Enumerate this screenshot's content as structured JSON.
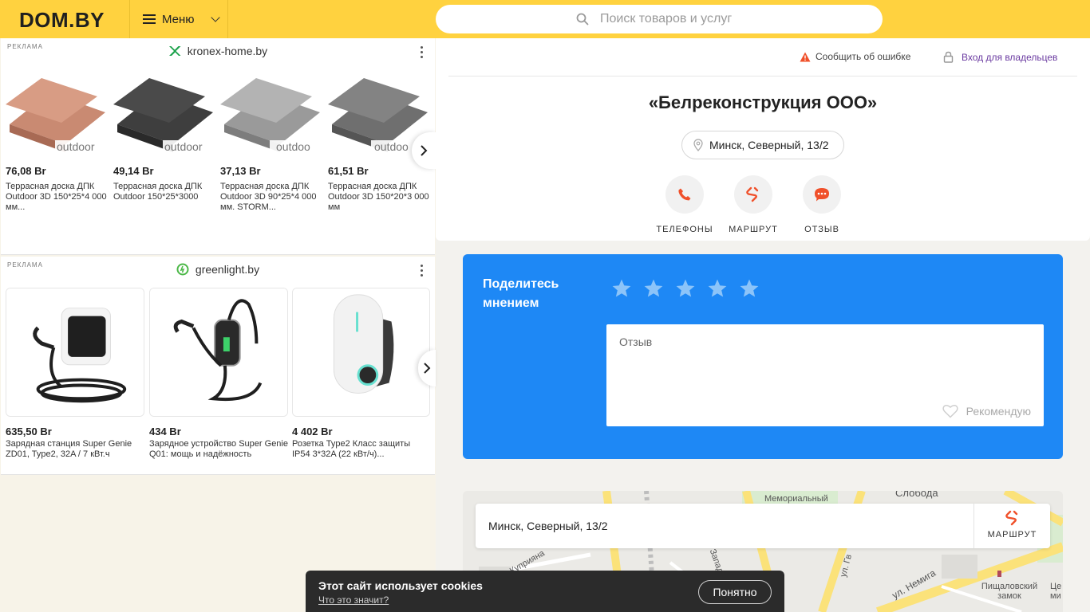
{
  "header": {
    "logo": "DOM.BY",
    "menu_label": "Меню",
    "search_placeholder": "Поиск товаров и услуг"
  },
  "ads": {
    "ad1": {
      "tag": "РЕКЛАМА",
      "source": "kronex-home.by",
      "products": [
        {
          "price": "76,08 Br",
          "name": "Террасная доска ДПК Outdoor 3D 150*25*4 000 мм...",
          "brand": "outdoor",
          "color": "#c98a72"
        },
        {
          "price": "49,14 Br",
          "name": "Террасная доска ДПК Outdoor 150*25*3000",
          "brand": "outdoor",
          "color": "#444444"
        },
        {
          "price": "37,13 Br",
          "name": "Террасная доска ДПК Outdoor 3D 90*25*4 000 мм. STORM...",
          "brand": "outdoo",
          "color": "#9a9a9a"
        },
        {
          "price": "61,51 Br",
          "name": "Террасная доска ДПК Outdoor 3D 150*20*3 000 мм",
          "brand": "outdoo",
          "color": "#6f6f6f"
        }
      ]
    },
    "ad2": {
      "tag": "РЕКЛАМА",
      "source": "greenlight.by",
      "products": [
        {
          "price": "635,50 Br",
          "name": "Зарядная станция Super Genie ZD01, Type2, 32A / 7 кВт.ч"
        },
        {
          "price": "434 Br",
          "name": "Зарядное устройство Super Genie Q01: мощь и надёжность"
        },
        {
          "price": "4 402 Br",
          "name": "Розетка Type2 Класс защиты IP54 3*32A (22 кВт/ч)..."
        }
      ]
    }
  },
  "card": {
    "report_label": "Сообщить об ошибке",
    "owners_label": "Вход для владельцев",
    "company_title": "«Белреконструкция ООО»",
    "address": "Минск, Северный, 13/2",
    "actions": [
      {
        "label": "ТЕЛЕФОНЫ"
      },
      {
        "label": "МАРШРУТ"
      },
      {
        "label": "ОТЗЫВ"
      }
    ]
  },
  "review": {
    "title": "Поделитесь мнением",
    "placeholder": "Отзыв",
    "recommend_label": "Рекомендую"
  },
  "map": {
    "address": "Минск, Северный, 13/2",
    "route_label": "МАРШРУТ",
    "labels": {
      "memorial": "Мемориальный",
      "sloboda": "Слобода",
      "kuprian": "ул. Куприяна",
      "zapadn": "Западн",
      "nemiga": "ул. Немига",
      "gv": "ул. Гв",
      "pishch": "Пищаловский замок",
      "tse": "Це ми"
    }
  },
  "cookie": {
    "text": "Этот сайт использует cookies",
    "link": "Что это значит?",
    "button": "Понятно"
  },
  "colors": {
    "header_yellow": "#ffd23f",
    "review_blue": "#1e88f5",
    "accent_orange": "#f0502a",
    "owners_purple": "#6a3aa0"
  }
}
